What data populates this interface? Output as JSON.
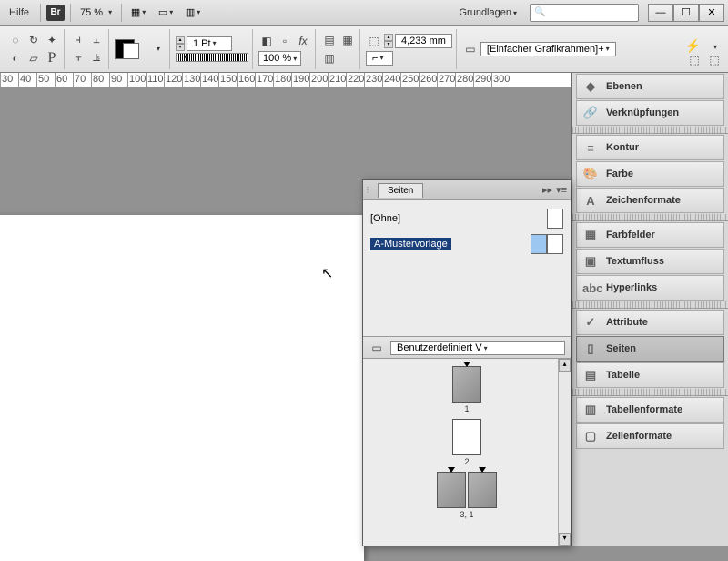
{
  "topbar": {
    "help": "Hilfe",
    "br": "Br",
    "zoom": "75 %",
    "workspace": "Grundlagen"
  },
  "control": {
    "stroke_weight": "1 Pt",
    "opacity": "100 %",
    "distance": "4,233 mm",
    "frame_preset": "[Einfacher Grafikrahmen]+"
  },
  "ruler_ticks": [
    30,
    40,
    50,
    60,
    70,
    80,
    90,
    100,
    110,
    120,
    130,
    140,
    150,
    160,
    170,
    180,
    190,
    200,
    210,
    220,
    230,
    240,
    250,
    260,
    270,
    280,
    290,
    300
  ],
  "right_panels": [
    {
      "icon": "◆",
      "label": "Ebenen"
    },
    {
      "icon": "🔗",
      "label": "Verknüpfungen"
    },
    {
      "icon": "≡",
      "label": "Kontur"
    },
    {
      "icon": "🎨",
      "label": "Farbe"
    },
    {
      "icon": "A",
      "label": "Zeichenformate"
    },
    {
      "icon": "▦",
      "label": "Farbfelder"
    },
    {
      "icon": "▣",
      "label": "Textumfluss"
    },
    {
      "icon": "abc",
      "label": "Hyperlinks"
    },
    {
      "icon": "✓",
      "label": "Attribute"
    },
    {
      "icon": "▯",
      "label": "Seiten",
      "active": true
    },
    {
      "icon": "▤",
      "label": "Tabelle"
    },
    {
      "icon": "▥",
      "label": "Tabellenformate"
    },
    {
      "icon": "▢",
      "label": "Zellenformate"
    }
  ],
  "pages_panel": {
    "tab": "Seiten",
    "none": "[Ohne]",
    "master": "A-Mustervorlage",
    "size_preset": "Benutzerdefiniert V",
    "page1": "1",
    "page2": "2",
    "page3": "3, 1"
  }
}
